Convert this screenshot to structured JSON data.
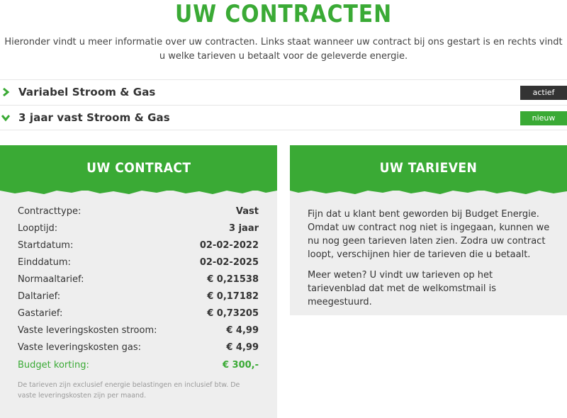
{
  "header": {
    "title": "UW CONTRACTEN",
    "intro": "Hieronder vindt u meer informatie over uw contracten. Links staat wanneer uw contract bij ons gestart is en rechts vindt u welke tarieven u betaalt voor de geleverde energie."
  },
  "contracts": [
    {
      "title": "Variabel Stroom & Gas",
      "badge": "actief",
      "badge_color": "#333333",
      "expanded": false,
      "chevron_icon": "chevron-right-icon"
    },
    {
      "title": "3 jaar vast Stroom & Gas",
      "badge": "nieuw",
      "badge_color": "#3aaa35",
      "expanded": true,
      "chevron_icon": "chevron-down-icon"
    }
  ],
  "contract_panel": {
    "title": "UW CONTRACT",
    "rows": [
      {
        "label": "Contracttype:",
        "value": "Vast"
      },
      {
        "label": "Looptijd:",
        "value": "3 jaar"
      },
      {
        "label": "Startdatum:",
        "value": "02-02-2022"
      },
      {
        "label": "Einddatum:",
        "value": "02-02-2025"
      },
      {
        "label": "Normaaltarief:",
        "value": "€ 0,21538"
      },
      {
        "label": "Daltarief:",
        "value": "€ 0,17182"
      },
      {
        "label": "Gastarief:",
        "value": "€ 0,73205"
      },
      {
        "label": "Vaste leveringskosten stroom:",
        "value": "€ 4,99"
      },
      {
        "label": "Vaste leveringskosten gas:",
        "value": "€ 4,99"
      },
      {
        "label": "Budget korting:",
        "value": "€ 300,-"
      }
    ],
    "footnote": "De tarieven zijn exclusief energie belastingen en inclusief btw. De vaste leveringskosten zijn per maand."
  },
  "tarieven_panel": {
    "title": "UW TARIEVEN",
    "paragraph_1": "Fijn dat u klant bent geworden bij Budget Energie. Omdat uw contract nog niet is ingegaan, kunnen we nu nog geen tarieven laten zien. Zodra uw contract loopt, verschijnen hier de tarieven die u betaalt.",
    "paragraph_2": "Meer weten? U vindt uw tarieven op het tarievenblad dat met de welkomstmail is meegestuurd."
  },
  "colors": {
    "brand_green": "#3aaa35",
    "dark": "#333333",
    "panel_bg": "#eeeeee"
  }
}
